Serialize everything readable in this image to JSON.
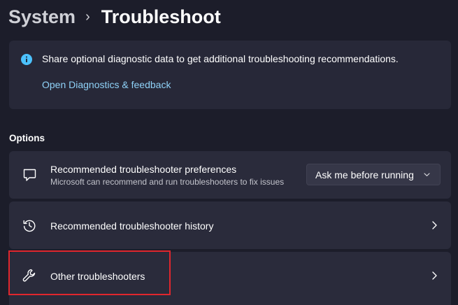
{
  "breadcrumb": {
    "parent": "System",
    "separator": "›",
    "current": "Troubleshoot"
  },
  "info_banner": {
    "icon": "info-icon",
    "text": "Share optional diagnostic data to get additional troubleshooting recommendations.",
    "link": "Open Diagnostics & feedback"
  },
  "options": {
    "section_title": "Options",
    "items": [
      {
        "icon": "chat-bubble-icon",
        "title": "Recommended troubleshooter preferences",
        "subtitle": "Microsoft can recommend and run troubleshooters to fix issues",
        "dropdown_value": "Ask me before running"
      },
      {
        "icon": "history-icon",
        "title": "Recommended troubleshooter history"
      },
      {
        "icon": "wrench-icon",
        "title": "Other troubleshooters",
        "highlighted": true
      }
    ]
  },
  "colors": {
    "background": "#1c1d2a",
    "card": "#2a2b3b",
    "link": "#8fd2f8",
    "info_accent": "#4cc2ff",
    "highlight": "#e0262d"
  }
}
